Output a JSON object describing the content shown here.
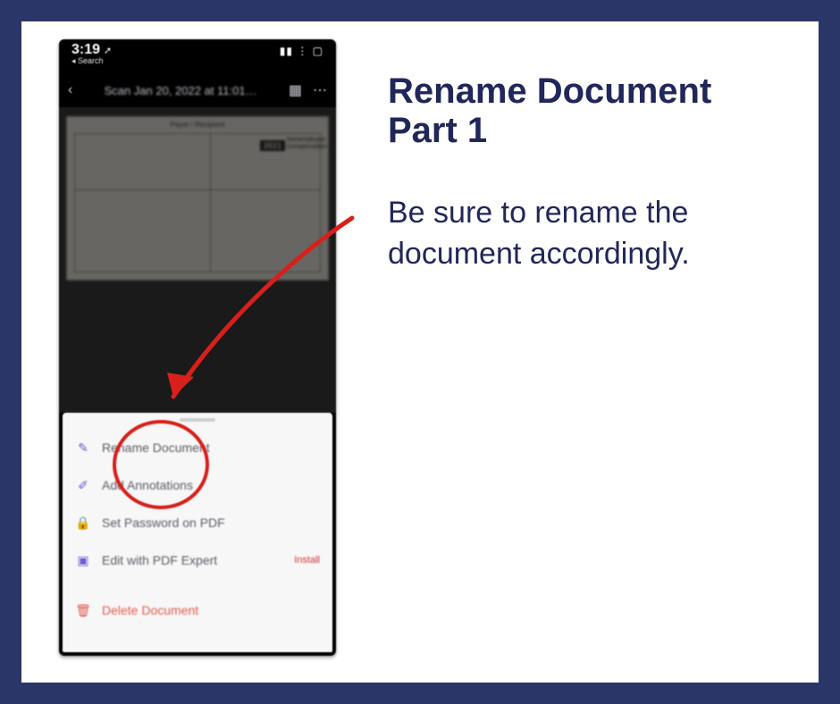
{
  "instruction": {
    "heading_line1": "Rename Document",
    "heading_line2": "Part 1",
    "body": "Be sure to rename the document accordingly."
  },
  "phone": {
    "statusbar": {
      "time": "3:19",
      "time_icon": "➚",
      "breadcrumb": "◂ Search",
      "signal_icons": "▮▮ ⋮ ▢"
    },
    "navbar": {
      "back_glyph": "‹",
      "title": "Scan Jan 20, 2022 at 11:01…",
      "grid_glyph": "▦",
      "more_glyph": "⋯"
    },
    "document_preview": {
      "form_title": "Payer / Recipient",
      "year_tag": "2021",
      "side_label": "Nonemployee Compensation"
    },
    "action_sheet": {
      "items": [
        {
          "icon": "✎",
          "label": "Rename Document",
          "trailing": "",
          "destructive": false
        },
        {
          "icon": "✐",
          "label": "Add Annotations",
          "trailing": "",
          "destructive": false
        },
        {
          "icon": "🔒",
          "label": "Set Password on PDF",
          "trailing": "",
          "destructive": false
        },
        {
          "icon": "▣",
          "label": "Edit with PDF Expert",
          "trailing": "Install",
          "destructive": false
        },
        {
          "icon": "🗑",
          "label": "Delete Document",
          "trailing": "",
          "destructive": true
        }
      ]
    }
  },
  "colors": {
    "frame": "#2a3568",
    "text": "#22275a",
    "accent_red": "#d8201b"
  }
}
